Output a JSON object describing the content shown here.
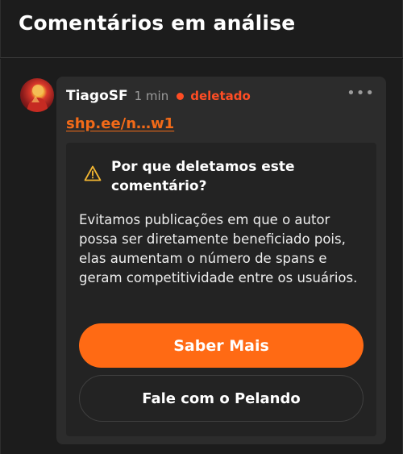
{
  "header": {
    "title": "Comentários em análise"
  },
  "comment": {
    "username": "TiagoSF",
    "time": "1 min",
    "status": "deletado",
    "link": "shp.ee/n…w1",
    "more_icon": "more-horizontal-icon"
  },
  "notice": {
    "icon": "warning-triangle-icon",
    "title": "Por que deletamos este comentário?",
    "body": "Evitamos publicações em que o autor possa ser diretamente beneficiado pois, elas aumentam o número de spans e geram competitividade entre os usuários.",
    "primary_button": "Saber Mais",
    "secondary_button": "Fale com o Pelando"
  },
  "colors": {
    "accent": "#ff6a14",
    "status": "#ff4d24",
    "link": "#f26a18",
    "warning": "#f2b632"
  }
}
